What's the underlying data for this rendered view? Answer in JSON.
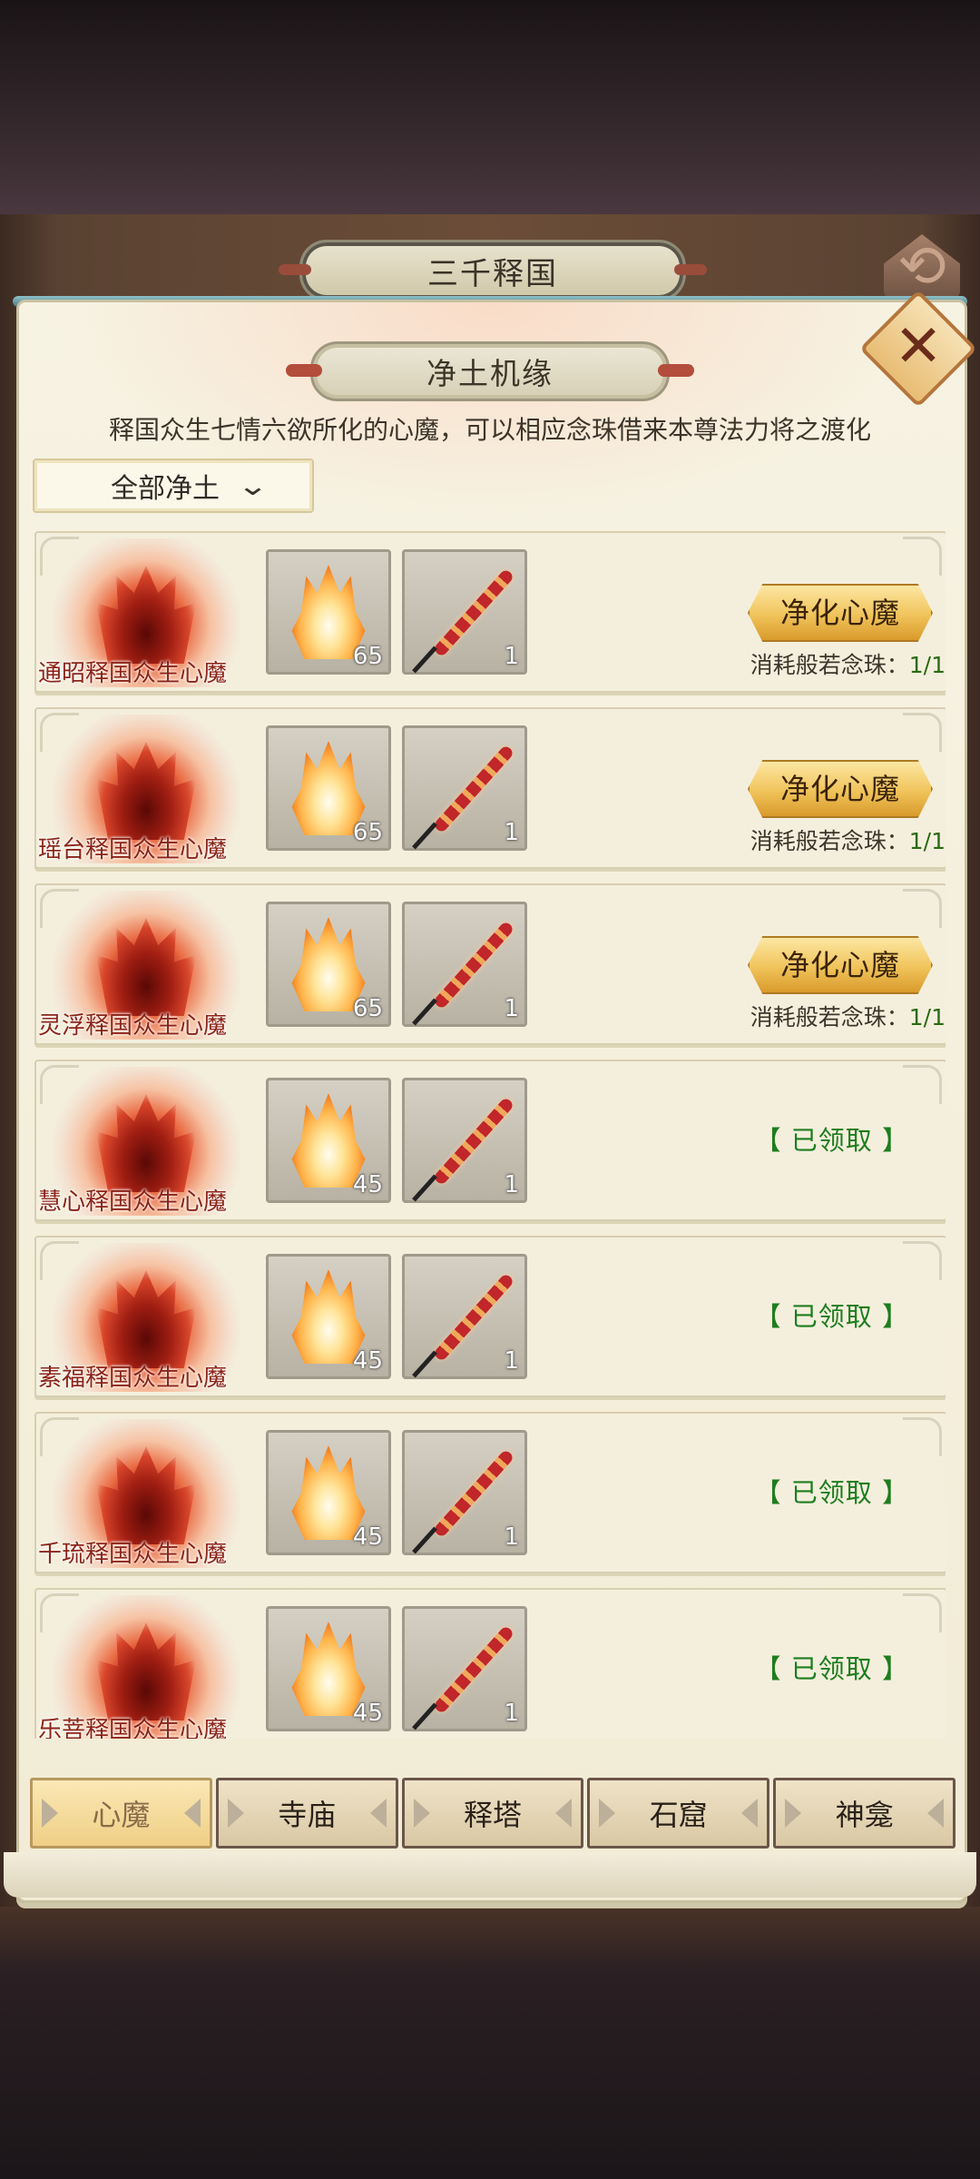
{
  "header": {
    "title": "三千释国",
    "back_icon": "back-arrow-icon"
  },
  "panel": {
    "title": "净土机缘",
    "description": "释国众生七情六欲所化的心魔，可以相应念珠借来本尊法力将之渡化",
    "filter": {
      "selected": "全部净土",
      "icon": "chevron-down-icon"
    },
    "close_icon": "close-icon"
  },
  "rows": [
    {
      "name": "通昭释国众生心魔",
      "item1_count": "65",
      "item2_count": "1",
      "action": "净化心魔",
      "cost_label": "消耗般若念珠：",
      "cost_value": "1/1",
      "claimed": ""
    },
    {
      "name": "瑶台释国众生心魔",
      "item1_count": "65",
      "item2_count": "1",
      "action": "净化心魔",
      "cost_label": "消耗般若念珠：",
      "cost_value": "1/1",
      "claimed": ""
    },
    {
      "name": "灵浮释国众生心魔",
      "item1_count": "65",
      "item2_count": "1",
      "action": "净化心魔",
      "cost_label": "消耗般若念珠：",
      "cost_value": "1/1",
      "claimed": ""
    },
    {
      "name": "慧心释国众生心魔",
      "item1_count": "45",
      "item2_count": "1",
      "action": "",
      "cost_label": "",
      "cost_value": "",
      "claimed": "【 已领取 】"
    },
    {
      "name": "素福释国众生心魔",
      "item1_count": "45",
      "item2_count": "1",
      "action": "",
      "cost_label": "",
      "cost_value": "",
      "claimed": "【 已领取 】"
    },
    {
      "name": "千琉释国众生心魔",
      "item1_count": "45",
      "item2_count": "1",
      "action": "",
      "cost_label": "",
      "cost_value": "",
      "claimed": "【 已领取 】"
    },
    {
      "name": "乐菩释国众生心魔",
      "item1_count": "45",
      "item2_count": "1",
      "action": "",
      "cost_label": "",
      "cost_value": "",
      "claimed": "【 已领取 】"
    }
  ],
  "tabs": [
    {
      "label": "心魔",
      "active": true
    },
    {
      "label": "寺庙",
      "active": false
    },
    {
      "label": "释塔",
      "active": false
    },
    {
      "label": "石窟",
      "active": false
    },
    {
      "label": "神龛",
      "active": false
    }
  ],
  "colors": {
    "claimed": "#1e7d1e",
    "cost_value": "#2b6a14",
    "demon_name": "#8b2418",
    "purify_button": "#f0c35a"
  }
}
